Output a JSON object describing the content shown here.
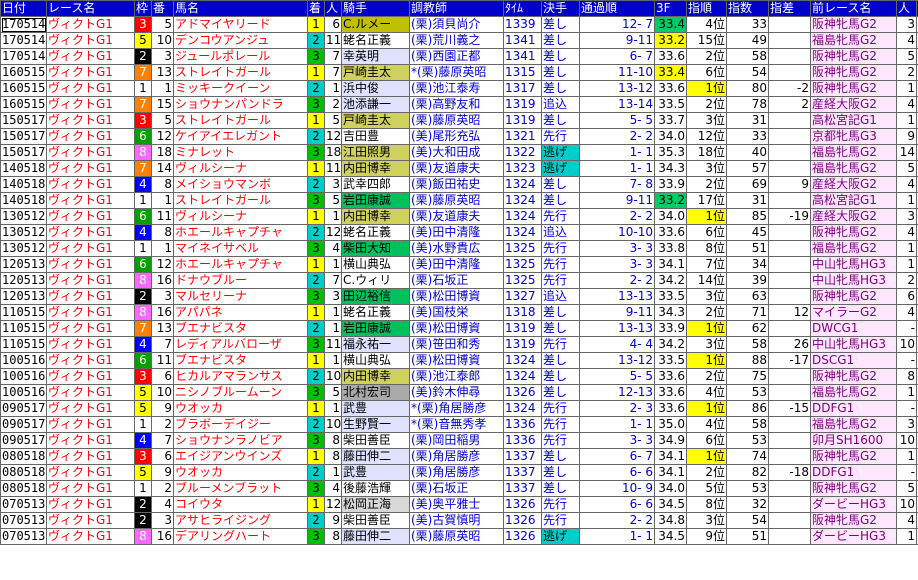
{
  "headers": [
    "日付",
    "レース名",
    "枠",
    "番",
    "馬名",
    "着",
    "人",
    "騎手",
    "調教師",
    "ﾀｲﾑ",
    "決手",
    "通過順",
    "3F",
    "指順",
    "指数",
    "指差",
    "前レース名",
    "人",
    "着"
  ],
  "colors": {
    "header_bg": "#0000cc",
    "waku": {
      "1": "#ffffff",
      "2": "#000000",
      "3": "#ff0000",
      "4": "#0000ff",
      "5": "#ffff00",
      "6": "#00a000",
      "7": "#ff8000",
      "8": "#ff66ff"
    }
  },
  "rows": [
    [
      "170514",
      "ヴィクトG1",
      "3",
      "5",
      "アドマイヤリード",
      "1",
      "6",
      "C.ルメー",
      "(栗)須貝尚介",
      "1339",
      "差し",
      "12- 7",
      "33.4",
      "4位",
      "33",
      "",
      "阪神牝馬G2",
      "3",
      "2"
    ],
    [
      "170514",
      "ヴィクトG1",
      "5",
      "10",
      "デンコウアンジュ",
      "2",
      "11",
      "蛯名正義",
      "(栗)荒川義之",
      "1341",
      "差し",
      "9-11",
      "33.2",
      "15位",
      "49",
      "",
      "福島牝馬G2",
      "4",
      "4"
    ],
    [
      "170514",
      "ヴィクトG1",
      "2",
      "3",
      "ジュールポレール",
      "3",
      "7",
      "幸英明",
      "(栗)西園正都",
      "1341",
      "差し",
      "6- 7",
      "33.6",
      "2位",
      "58",
      "",
      "阪神牝馬G2",
      "5",
      "3"
    ],
    [
      "160515",
      "ヴィクトG1",
      "7",
      "13",
      "ストレイトガール",
      "1",
      "7",
      "戸崎圭太",
      "*(栗)藤原英昭",
      "1315",
      "差し",
      "11-10",
      "33.4",
      "6位",
      "54",
      "",
      "阪神牝馬G2",
      "2",
      "9"
    ],
    [
      "160515",
      "ヴィクトG1",
      "1",
      "1",
      "ミッキークイーン",
      "2",
      "1",
      "浜中俊",
      "(栗)池江泰寿",
      "1317",
      "差し",
      "13-12",
      "33.6",
      "1位",
      "80",
      "-2",
      "阪神牝馬G2",
      "1",
      "2"
    ],
    [
      "160515",
      "ヴィクトG1",
      "7",
      "15",
      "ショウナンパンドラ",
      "3",
      "2",
      "池添謙一",
      "(栗)高野友和",
      "1319",
      "追込",
      "13-14",
      "33.5",
      "2位",
      "78",
      "2",
      "産経大阪G2",
      "4",
      "4"
    ],
    [
      "150517",
      "ヴィクトG1",
      "3",
      "5",
      "ストレイトガール",
      "1",
      "5",
      "戸崎圭太",
      "(栗)藤原英昭",
      "1319",
      "差し",
      "5- 5",
      "33.7",
      "3位",
      "31",
      "",
      "高松宮記G1",
      "1",
      "13"
    ],
    [
      "150517",
      "ヴィクトG1",
      "6",
      "12",
      "ケイアイエレガント",
      "2",
      "12",
      "吉田豊",
      "(美)尾形充弘",
      "1321",
      "先行",
      "2- 2",
      "34.0",
      "12位",
      "33",
      "",
      "京都牝馬G3",
      "9",
      "2"
    ],
    [
      "150517",
      "ヴィクトG1",
      "8",
      "18",
      "ミナレット",
      "3",
      "18",
      "江田照男",
      "(美)大和田成",
      "1322",
      "逃げ",
      "1- 1",
      "35.3",
      "18位",
      "40",
      "",
      "福島牝馬G2",
      "14",
      "5"
    ],
    [
      "140518",
      "ヴィクトG1",
      "7",
      "14",
      "ヴィルシーナ",
      "1",
      "11",
      "内田博幸",
      "(栗)友道康夫",
      "1323",
      "逃げ",
      "1- 1",
      "34.3",
      "3位",
      "57",
      "",
      "福島牝馬G2",
      "5",
      "8"
    ],
    [
      "140518",
      "ヴィクトG1",
      "4",
      "8",
      "メイショウマンボ",
      "2",
      "3",
      "武幸四郎",
      "(栗)飯田祐史",
      "1324",
      "差し",
      "7- 8",
      "33.9",
      "2位",
      "69",
      "9",
      "産経大阪G2",
      "4",
      "7"
    ],
    [
      "140518",
      "ヴィクトG1",
      "1",
      "1",
      "ストレイトガール",
      "3",
      "5",
      "岩田康誠",
      "(栗)藤原英昭",
      "1324",
      "差し",
      "9-11",
      "33.2",
      "17位",
      "31",
      "",
      "高松宮記G1",
      "1",
      "3"
    ],
    [
      "130512",
      "ヴィクトG1",
      "6",
      "11",
      "ヴィルシーナ",
      "1",
      "1",
      "内田博幸",
      "(栗)友道康夫",
      "1324",
      "先行",
      "2- 2",
      "34.0",
      "1位",
      "85",
      "-19",
      "産経大阪G2",
      "3",
      "6"
    ],
    [
      "130512",
      "ヴィクトG1",
      "4",
      "8",
      "ホエールキャプチャ",
      "2",
      "12",
      "蛯名正義",
      "(美)田中清隆",
      "1324",
      "追込",
      "10-10",
      "33.6",
      "6位",
      "45",
      "",
      "阪神牝馬G2",
      "4",
      "4"
    ],
    [
      "130512",
      "ヴィクトG1",
      "1",
      "1",
      "マイネイサベル",
      "3",
      "4",
      "柴田大知",
      "(美)水野貴広",
      "1325",
      "先行",
      "3- 3",
      "33.8",
      "8位",
      "51",
      "",
      "福島牝馬G2",
      "1",
      "1"
    ],
    [
      "120513",
      "ヴィクトG1",
      "6",
      "12",
      "ホエールキャプチャ",
      "1",
      "1",
      "横山典弘",
      "(美)田中清隆",
      "1325",
      "先行",
      "3- 3",
      "34.1",
      "7位",
      "34",
      "",
      "中山牝馬HG3",
      "1",
      "4"
    ],
    [
      "120513",
      "ヴィクトG1",
      "8",
      "16",
      "ドナウブルー",
      "2",
      "7",
      "C.ウィリ",
      "(栗)石坂正",
      "1325",
      "先行",
      "2- 2",
      "34.2",
      "14位",
      "39",
      "",
      "中山牝馬HG3",
      "2",
      "2"
    ],
    [
      "120513",
      "ヴィクトG1",
      "2",
      "3",
      "マルセリーナ",
      "3",
      "3",
      "田辺裕信",
      "(栗)松田博資",
      "1327",
      "追込",
      "13-13",
      "33.5",
      "3位",
      "63",
      "",
      "阪神牝馬G2",
      "6",
      "2"
    ],
    [
      "110515",
      "ヴィクトG1",
      "8",
      "16",
      "アパパネ",
      "1",
      "1",
      "蛯名正義",
      "(美)国枝栄",
      "1318",
      "差し",
      "9-11",
      "34.3",
      "2位",
      "71",
      "12",
      "マイラーG2",
      "4",
      "4"
    ],
    [
      "110515",
      "ヴィクトG1",
      "7",
      "13",
      "ブエナビスタ",
      "2",
      "1",
      "岩田康誠",
      "(栗)松田博資",
      "1319",
      "差し",
      "13-13",
      "33.9",
      "1位",
      "62",
      "",
      "DWCG1",
      "-",
      "8"
    ],
    [
      "110515",
      "ヴィクトG1",
      "4",
      "7",
      "レディアルバローザ",
      "3",
      "11",
      "福永祐一",
      "(栗)笹田和秀",
      "1319",
      "先行",
      "4- 4",
      "34.2",
      "3位",
      "58",
      "26",
      "中山牝馬HG3",
      "10",
      "1"
    ],
    [
      "100516",
      "ヴィクトG1",
      "6",
      "11",
      "ブエナビスタ",
      "1",
      "1",
      "横山典弘",
      "(栗)松田博資",
      "1324",
      "差し",
      "13-12",
      "33.5",
      "1位",
      "88",
      "-17",
      "DSCG1",
      "-",
      "2"
    ],
    [
      "100516",
      "ヴィクトG1",
      "3",
      "6",
      "ヒカルアマランサス",
      "2",
      "10",
      "内田博幸",
      "(栗)池江泰郎",
      "1324",
      "差し",
      "5- 5",
      "33.6",
      "2位",
      "75",
      "",
      "阪神牝馬G2",
      "8",
      "3"
    ],
    [
      "100516",
      "ヴィクトG1",
      "5",
      "10",
      "ニシノブルームーン",
      "3",
      "5",
      "北村宏司",
      "(美)鈴木伸尋",
      "1326",
      "差し",
      "12-13",
      "33.6",
      "4位",
      "53",
      "",
      "福島牝馬G2",
      "1",
      "1"
    ],
    [
      "090517",
      "ヴィクトG1",
      "5",
      "9",
      "ウオッカ",
      "1",
      "1",
      "武豊",
      "*(栗)角居勝彦",
      "1324",
      "先行",
      "2- 3",
      "33.6",
      "1位",
      "86",
      "-15",
      "DDFG1",
      "-",
      "7"
    ],
    [
      "090517",
      "ヴィクトG1",
      "1",
      "2",
      "ブラボーデイジー",
      "2",
      "10",
      "生野賢一",
      "*(栗)音無秀孝",
      "1336",
      "先行",
      "1- 1",
      "35.0",
      "4位",
      "58",
      "",
      "福島牝馬G2",
      "3",
      "2"
    ],
    [
      "090517",
      "ヴィクトG1",
      "4",
      "7",
      "ショウナンラノビア",
      "3",
      "8",
      "柴田善臣",
      "(栗)岡田稲男",
      "1336",
      "先行",
      "3- 3",
      "34.9",
      "6位",
      "53",
      "",
      "卯月SH1600",
      "10",
      "1"
    ],
    [
      "080518",
      "ヴィクトG1",
      "3",
      "6",
      "エイジアンウインズ",
      "1",
      "8",
      "藤田伸二",
      "(栗)角居勝彦",
      "1337",
      "差し",
      "6- 7",
      "34.1",
      "1位",
      "74",
      "",
      "阪神牝馬G2",
      "1",
      "1"
    ],
    [
      "080518",
      "ヴィクトG1",
      "5",
      "9",
      "ウオッカ",
      "2",
      "1",
      "武豊",
      "(栗)角居勝彦",
      "1337",
      "差し",
      "6- 6",
      "34.1",
      "2位",
      "82",
      "-18",
      "DDFG1",
      "-",
      "4"
    ],
    [
      "080518",
      "ヴィクトG1",
      "1",
      "2",
      "ブルーメンブラット",
      "3",
      "4",
      "後藤浩輝",
      "(栗)石坂正",
      "1337",
      "差し",
      "10- 9",
      "34.0",
      "5位",
      "53",
      "",
      "阪神牝馬G2",
      "5",
      "2"
    ],
    [
      "070513",
      "ヴィクトG1",
      "2",
      "4",
      "コイウタ",
      "1",
      "12",
      "松岡正海",
      "(美)奥平雅士",
      "1326",
      "先行",
      "6- 6",
      "34.5",
      "8位",
      "32",
      "",
      "ダービーHG3",
      "10",
      "1"
    ],
    [
      "070513",
      "ヴィクトG1",
      "2",
      "3",
      "アサヒライジング",
      "2",
      "9",
      "柴田善臣",
      "(美)古賀慎明",
      "1326",
      "先行",
      "2- 2",
      "34.8",
      "3位",
      "54",
      "",
      "阪神牝馬G2",
      "4",
      "1"
    ],
    [
      "070513",
      "ヴィクトG1",
      "8",
      "16",
      "デアリングハート",
      "3",
      "8",
      "藤田伸二",
      "(栗)藤原英昭",
      "1326",
      "逃げ",
      "1- 1",
      "34.5",
      "9位",
      "51",
      "",
      "ダービーHG3",
      "1",
      "1"
    ]
  ]
}
